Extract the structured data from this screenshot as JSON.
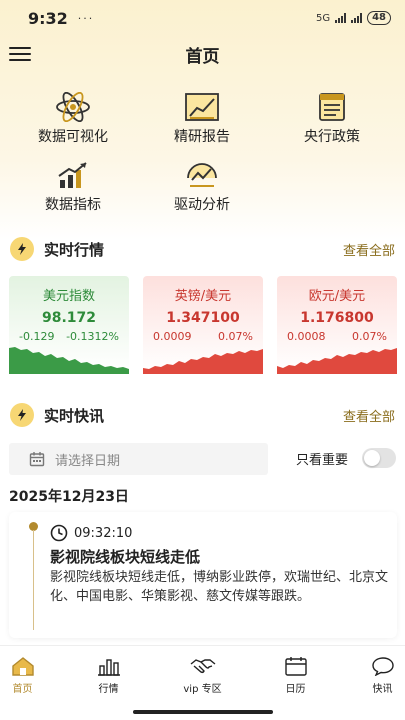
{
  "status_bar": {
    "time": "9:32",
    "left_icons": "···",
    "network": "5G",
    "battery": "48"
  },
  "header": {
    "title": "首页"
  },
  "shortcuts": [
    {
      "label": "数据可视化",
      "icon": "atom-icon"
    },
    {
      "label": "精研报告",
      "icon": "report-chart-icon"
    },
    {
      "label": "央行政策",
      "icon": "policy-doc-icon"
    },
    {
      "label": "数据指标",
      "icon": "bar-chart-up-icon"
    },
    {
      "label": "驱动分析",
      "icon": "analysis-gauge-icon"
    }
  ],
  "market": {
    "title": "实时行情",
    "view_all": "查看全部",
    "cards": [
      {
        "name": "美元指数",
        "price": "98.172",
        "change": "-0.129",
        "change_pct": "-0.1312%",
        "trend": "down",
        "color": "#2e8b3a"
      },
      {
        "name": "英镑/美元",
        "price": "1.347100",
        "change": "0.0009",
        "change_pct": "0.07%",
        "trend": "up",
        "color": "#c8372f"
      },
      {
        "name": "欧元/美元",
        "price": "1.176800",
        "change": "0.0008",
        "change_pct": "0.07%",
        "trend": "up",
        "color": "#c8372f"
      }
    ]
  },
  "flash": {
    "title": "实时快讯",
    "view_all": "查看全部",
    "date_placeholder": "请选择日期",
    "important_only": "只看重要",
    "important_on": false,
    "date_heading": "2025年12月23日",
    "items": [
      {
        "time": "09:32:10",
        "title": "影视院线板块短线走低",
        "body": "影视院线板块短线走低，博纳影业跌停，欢瑞世纪、北京文化、中国电影、华策影视、慈文传媒等跟跌。"
      }
    ]
  },
  "tab_bar": {
    "tabs": [
      {
        "label": "首页",
        "icon": "home-icon",
        "active": true
      },
      {
        "label": "行情",
        "icon": "market-bars-icon",
        "active": false
      },
      {
        "label": "vip 专区",
        "icon": "handshake-icon",
        "active": false
      },
      {
        "label": "日历",
        "icon": "calendar-icon",
        "active": false
      },
      {
        "label": "快讯",
        "icon": "chat-bubble-icon",
        "active": false
      }
    ]
  },
  "colors": {
    "accent": "#b28a2e",
    "up": "#c8372f",
    "down": "#2e8b3a",
    "section_badge": "#f7d774"
  }
}
